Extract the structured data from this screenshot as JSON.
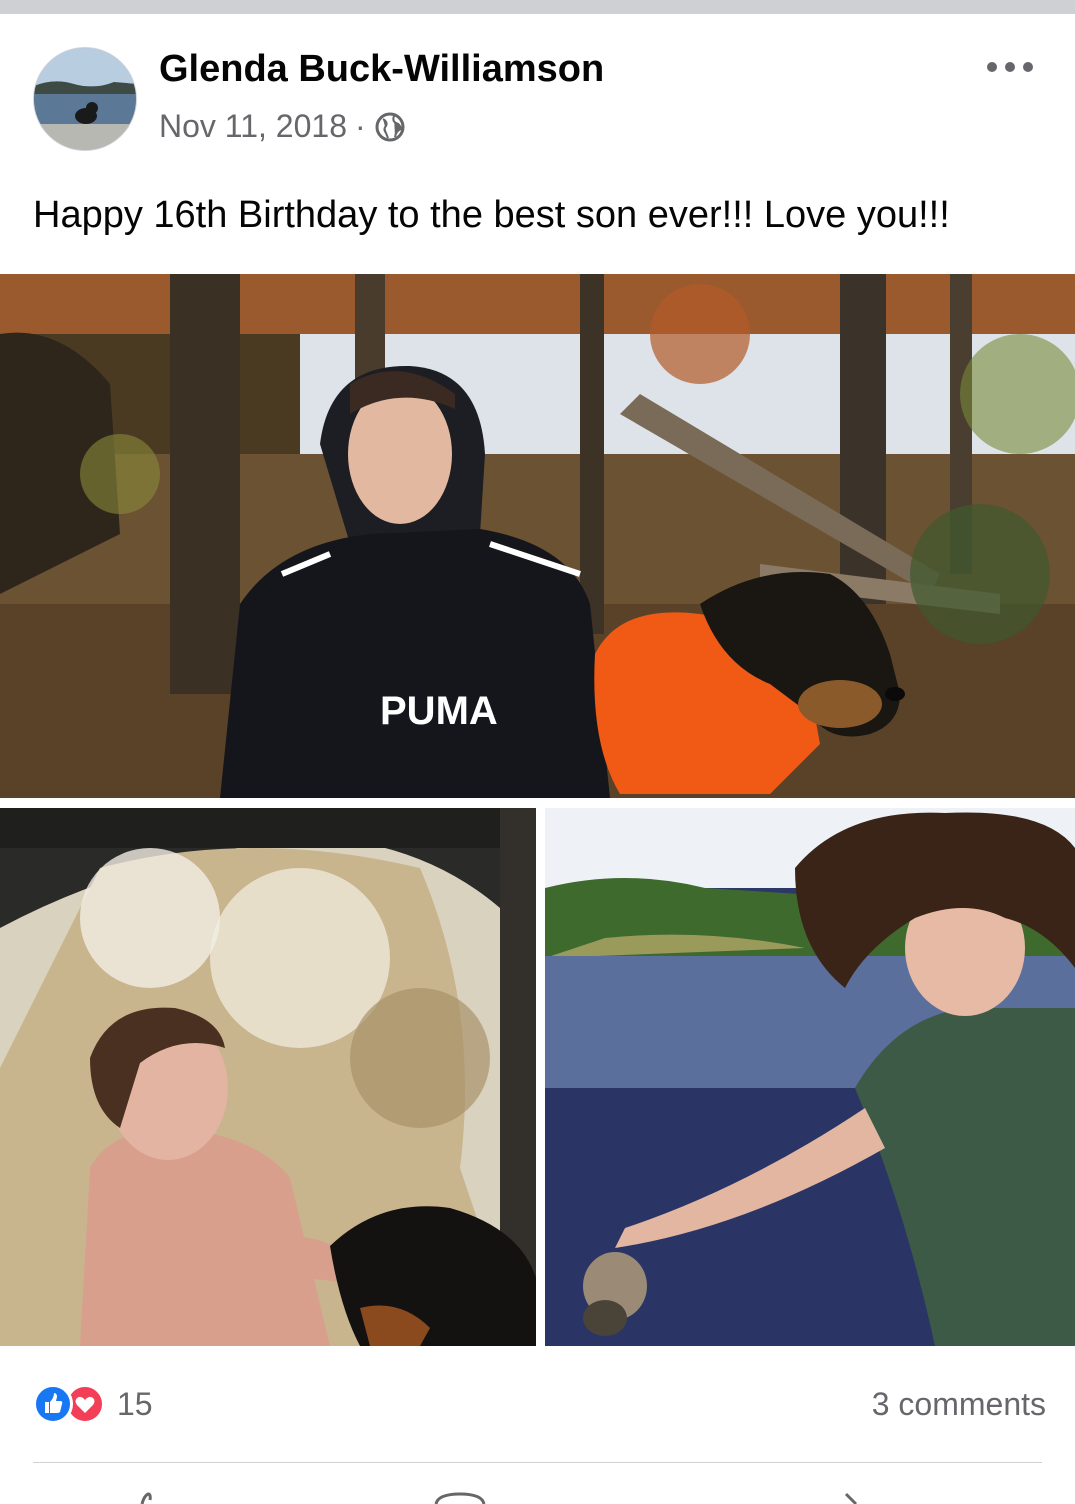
{
  "post": {
    "author": "Glenda Buck-Williamson",
    "date": "Nov 11, 2018",
    "separator": "·",
    "privacy_icon": "globe-icon",
    "text": "Happy 16th Birthday to the best son ever!!!  Love you!!!"
  },
  "photos": [
    {
      "name": "teen-in-hoodie-with-dog-by-lake",
      "shirt_text": "PUMA"
    },
    {
      "name": "teen-in-waterfall-with-dog"
    },
    {
      "name": "teen-at-lake-holding-object"
    }
  ],
  "footer": {
    "reaction_icons": [
      "like-icon",
      "love-icon"
    ],
    "reaction_count": "15",
    "comments": "3 comments",
    "actions": [
      "like-icon",
      "comment-icon",
      "share-icon"
    ]
  },
  "colors": {
    "brand": "#1877f2",
    "love": "#f33e58",
    "muted": "#65676b"
  }
}
